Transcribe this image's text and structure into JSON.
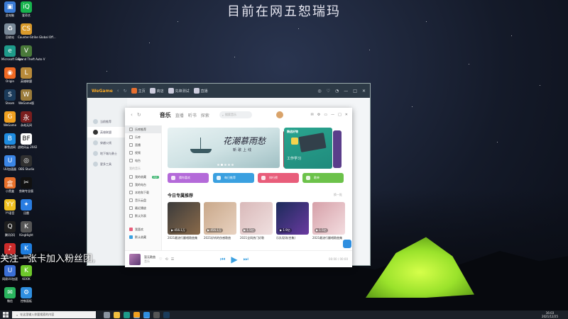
{
  "desktop": {
    "title": "目前在网五恕瑞玛",
    "overlay": "关注一张卡加入粉丝团,",
    "icons": [
      {
        "label": "此电脑",
        "icon": "computer-icon",
        "color": "#3a7bd5",
        "glyph": "▣"
      },
      {
        "label": "爱奇艺",
        "icon": "iqiyi-icon",
        "color": "#17b34d",
        "glyph": "iQ"
      },
      {
        "label": "回收站",
        "icon": "recycle-bin-icon",
        "color": "#7a8a99",
        "glyph": "♻"
      },
      {
        "label": "Counter-Strike Global Off...",
        "icon": "csgo-icon",
        "color": "#d99a2b",
        "glyph": "CS"
      },
      {
        "label": "Microsoft Edge",
        "icon": "edge-icon",
        "color": "#1e9b8a",
        "glyph": "e"
      },
      {
        "label": "Grand Theft Auto V",
        "icon": "gta-icon",
        "color": "#4a7a3a",
        "glyph": "V"
      },
      {
        "label": "Origin",
        "icon": "origin-icon",
        "color": "#f06a23",
        "glyph": "◉"
      },
      {
        "label": "英雄联盟",
        "icon": "lol-icon",
        "color": "#b88a3a",
        "glyph": "L"
      },
      {
        "label": "Steam",
        "icon": "steam-icon",
        "color": "#1b3b5a",
        "glyph": "S"
      },
      {
        "label": "WeGame版",
        "icon": "wegame-lol-icon",
        "color": "#9a7b3a",
        "glyph": "W"
      },
      {
        "label": "WeGame",
        "icon": "wegame-icon",
        "color": "#f0a020",
        "glyph": "G"
      },
      {
        "label": "永劫无间",
        "icon": "naraka-icon",
        "color": "#7a1e1e",
        "glyph": "永"
      },
      {
        "label": "暴雪战网",
        "icon": "battlenet-icon",
        "color": "#1f8ce0",
        "glyph": "B"
      },
      {
        "label": "战地风云 2042",
        "icon": "battlefield-icon",
        "color": "#ffffff",
        "glyph": "BF"
      },
      {
        "label": "UU加速器",
        "icon": "uu-icon",
        "color": "#3b86e6",
        "glyph": "U"
      },
      {
        "label": "OBS Studio",
        "icon": "obs-icon",
        "color": "#303030",
        "glyph": "◎"
      },
      {
        "label": "小黑盒",
        "icon": "heybox-icon",
        "color": "#e8702a",
        "glyph": "盒"
      },
      {
        "label": "剪映专业版",
        "icon": "jianying-icon",
        "color": "#111111",
        "glyph": "✂"
      },
      {
        "label": "YY语音",
        "icon": "yy-icon",
        "color": "#f0c020",
        "glyph": "YY"
      },
      {
        "label": "迅雷",
        "icon": "thunder-icon",
        "color": "#2a7de1",
        "glyph": "✦"
      },
      {
        "label": "腾讯QQ",
        "icon": "qq-icon",
        "color": "#1f1f1f",
        "glyph": "Q"
      },
      {
        "label": "KingHight",
        "icon": "kinghight-icon",
        "color": "#555555",
        "glyph": "K"
      },
      {
        "label": "网易云音乐",
        "icon": "netease-music-icon",
        "color": "#cc2b2b",
        "glyph": "♪"
      },
      {
        "label": "酷狗",
        "icon": "kugou-icon",
        "color": "#1f7ee0",
        "glyph": "K"
      },
      {
        "label": "网易UU加速",
        "icon": "uu-net-icon",
        "color": "#3b6fd6",
        "glyph": "U"
      },
      {
        "label": "KOOK",
        "icon": "kook-icon",
        "color": "#6ec82b",
        "glyph": "K"
      },
      {
        "label": "微信",
        "icon": "wechat-icon",
        "color": "#2ab55e",
        "glyph": "✉"
      },
      {
        "label": "控制面板",
        "icon": "control-panel-icon",
        "color": "#2f8fe0",
        "glyph": "⚙"
      }
    ]
  },
  "wegame": {
    "logo": "WeGame",
    "tabs": [
      {
        "label": "主页",
        "active": true
      },
      {
        "label": "商店",
        "active": false
      },
      {
        "label": "先锋测试",
        "active": false
      },
      {
        "label": "直播",
        "active": false
      }
    ],
    "controls": [
      "◎",
      "♡",
      "◔",
      "—",
      "□",
      "✕"
    ],
    "sidebar": [
      {
        "label": "当前推荐"
      },
      {
        "label": "英雄联盟",
        "active": true
      },
      {
        "label": "穿越火线"
      },
      {
        "label": "地下城与勇士"
      },
      {
        "label": "更多工具"
      }
    ]
  },
  "music": {
    "brand": "音乐",
    "tabs": [
      "直播",
      "听书",
      "探索"
    ],
    "search_placeholder": "搜索音乐",
    "controls": [
      "✉",
      "⚙",
      "▭",
      "—",
      "□",
      "✕"
    ],
    "sidebar_top": [
      {
        "label": "乐库推荐",
        "active": true
      },
      {
        "label": "乐库"
      },
      {
        "label": "直播"
      },
      {
        "label": "视频"
      },
      {
        "label": "电台"
      }
    ],
    "sidebar_section": "我的音乐",
    "sidebar_mine": [
      {
        "label": "我的收藏",
        "badge": "同步"
      },
      {
        "label": "我的电台"
      },
      {
        "label": "本地和下载"
      },
      {
        "label": "音乐云盘"
      },
      {
        "label": "最近播放"
      },
      {
        "label": "默认列表"
      }
    ],
    "sidebar_bottom": [
      {
        "label": "我喜欢"
      },
      {
        "label": "默认收藏"
      }
    ],
    "banner": {
      "title": "花潮慕雨愁",
      "subtitle": "新歌上线"
    },
    "promo": {
      "tag": "精选好物",
      "caption": "工作学习"
    },
    "quick_actions": [
      {
        "label": "猜你喜欢",
        "color": "#b46ad9"
      },
      {
        "label": "每日推荐",
        "color": "#3aa0e0"
      },
      {
        "label": "排行榜",
        "color": "#e85d7a"
      },
      {
        "label": "歌单",
        "color": "#6cc24a"
      }
    ],
    "section_title": "今日专属推荐",
    "section_more": "换一批",
    "cards": [
      {
        "caption": "2021最流行翻唱歌曲集",
        "plays": "456.1万",
        "colors": [
          "#3b3b3b",
          "#8a6a4a"
        ]
      },
      {
        "caption": "2021好听的伤感歌曲",
        "plays": "456.1万",
        "colors": [
          "#c9a88a",
          "#e8d2c0"
        ]
      },
      {
        "caption": "2021全网热门好歌",
        "plays": "1.5亿",
        "colors": [
          "#d9b9b9",
          "#f0e0e0"
        ]
      },
      {
        "caption": "乐队现场(合集)",
        "plays": "1.9亿",
        "colors": [
          "#1b2b5a",
          "#6a3aa0"
        ]
      },
      {
        "caption": "2021最流行翻唱歌曲集",
        "plays": "1.5亿",
        "colors": [
          "#d6a0a8",
          "#f3dde0"
        ]
      }
    ],
    "player": {
      "song": "暂无歌曲",
      "artist": "音乐",
      "time": "00:00 / 00:00",
      "controls": [
        "⏮",
        "▶",
        "⏭"
      ],
      "extras": [
        "♡",
        "⟲",
        "☰"
      ]
    }
  },
  "taskbar": {
    "search_placeholder": "在这里输入你要搜索的内容",
    "apps": [
      {
        "icon": "task-view-icon",
        "color": "#8a94a0"
      },
      {
        "icon": "explorer-icon",
        "color": "#f0c040"
      },
      {
        "icon": "edge-taskbar-icon",
        "color": "#1e9b8a"
      },
      {
        "icon": "wegame-taskbar-icon",
        "color": "#f0a020",
        "active": true
      },
      {
        "icon": "music-taskbar-icon",
        "color": "#2f8fe0",
        "active": true
      },
      {
        "icon": "obs-taskbar-icon",
        "color": "#555555"
      },
      {
        "icon": "steam-taskbar-icon",
        "color": "#1b3b5a"
      }
    ],
    "clock_time": "16:03",
    "clock_date": "2021/12/25"
  },
  "colors": {
    "accent": "#3aa0e0",
    "wegame_bar": "#2d3a46",
    "tent": "#9ae22b"
  }
}
